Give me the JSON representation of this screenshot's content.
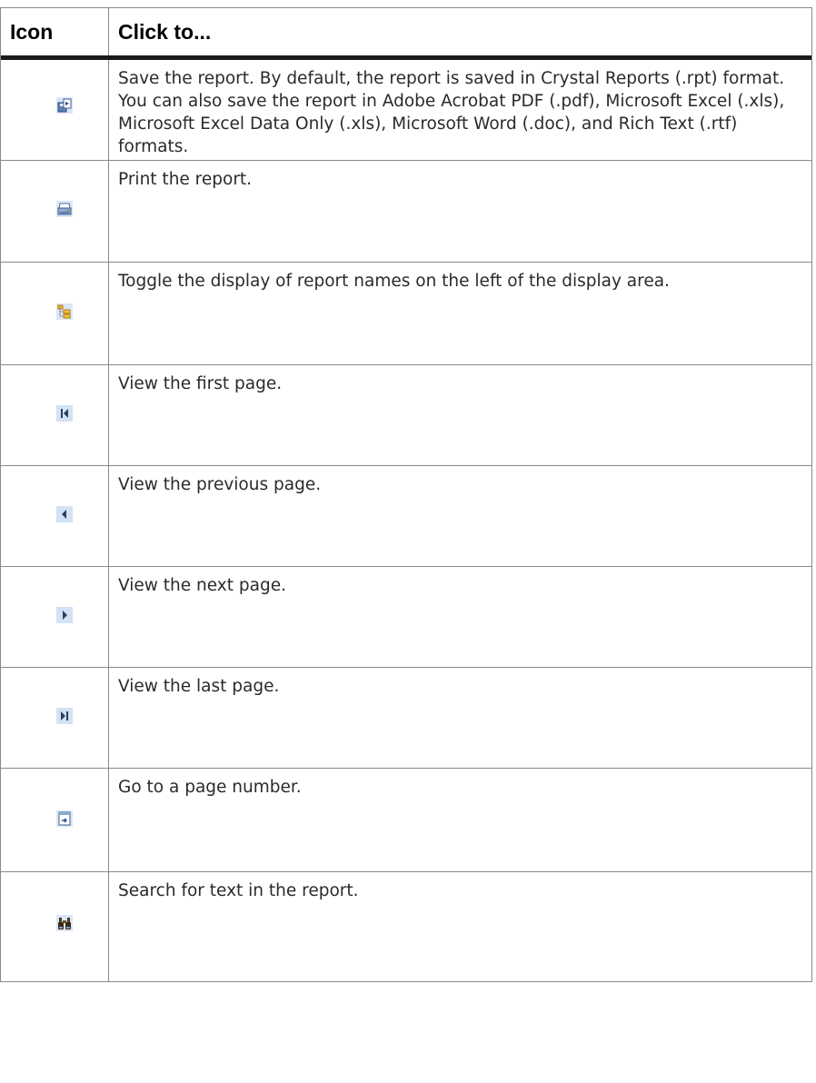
{
  "table": {
    "headers": {
      "icon": "Icon",
      "action": "Click to..."
    },
    "rows": [
      {
        "icon": "save-icon",
        "text": "Save the report. By default, the report is saved in Crystal Reports (.rpt) format. You can also save the report in Adobe Acrobat PDF (.pdf), Microsoft Excel (.xls), Microsoft Excel Data Only (.xls), Microsoft Word (.doc), and Rich Text (.rtf) formats."
      },
      {
        "icon": "print-icon",
        "text": "Print the report."
      },
      {
        "icon": "tree-toggle-icon",
        "text": "Toggle the display of report names on the left of the display area."
      },
      {
        "icon": "first-page-icon",
        "text": "View the first page."
      },
      {
        "icon": "previous-page-icon",
        "text": "View the previous page."
      },
      {
        "icon": "next-page-icon",
        "text": "View the next page."
      },
      {
        "icon": "last-page-icon",
        "text": "View the last page."
      },
      {
        "icon": "go-to-page-icon",
        "text": "Go to a page number."
      },
      {
        "icon": "binoculars-icon",
        "text": "Search for text in the report."
      }
    ]
  }
}
